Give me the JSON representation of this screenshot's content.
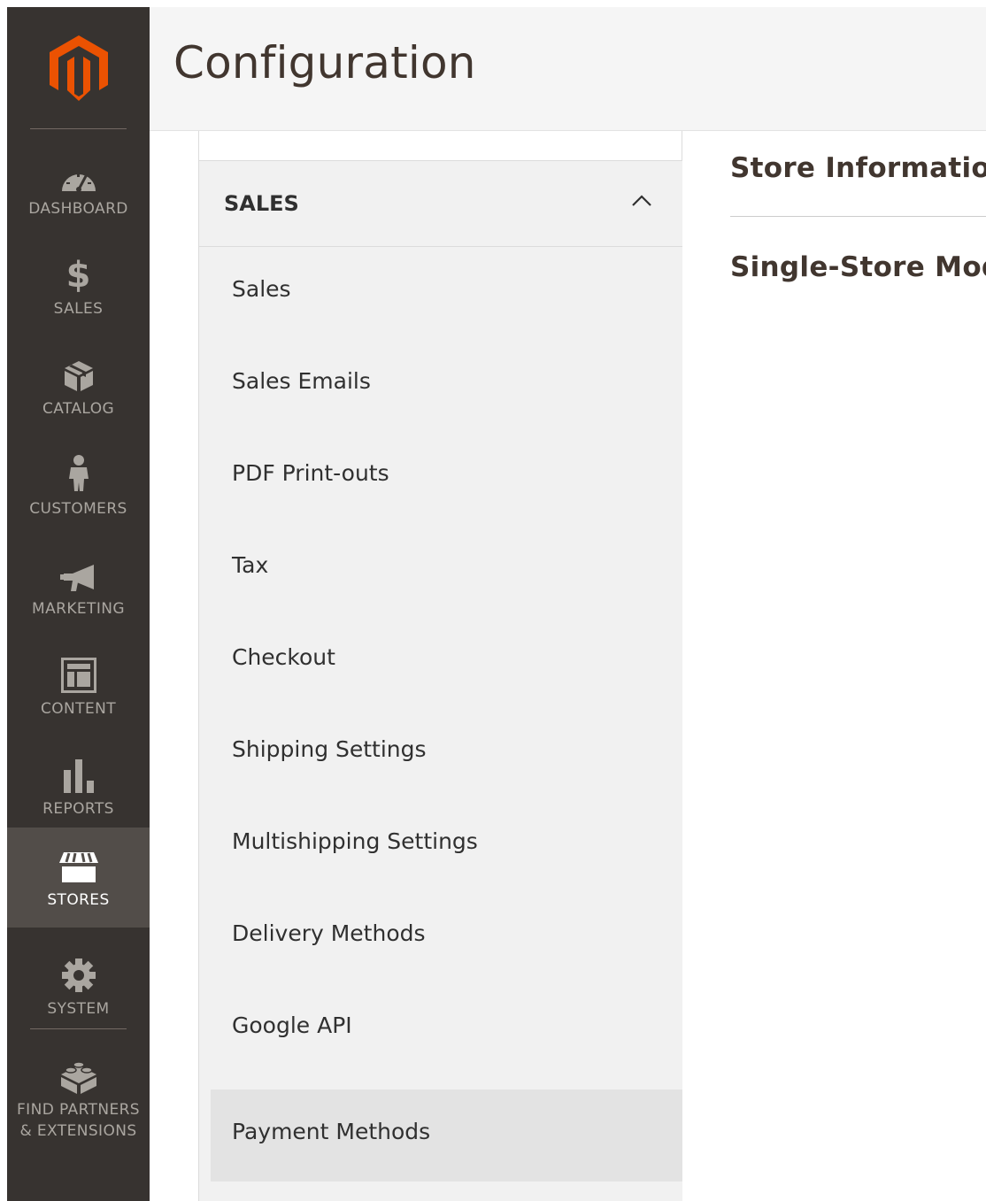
{
  "brand": {
    "logo": "magento-logo-icon",
    "accent_color": "#eb5202"
  },
  "admin_nav": {
    "items": [
      {
        "label": "DASHBOARD",
        "icon": "dashboard-gauge-icon"
      },
      {
        "label": "SALES",
        "icon": "dollar-icon"
      },
      {
        "label": "CATALOG",
        "icon": "box-icon"
      },
      {
        "label": "CUSTOMERS",
        "icon": "person-icon"
      },
      {
        "label": "MARKETING",
        "icon": "megaphone-icon"
      },
      {
        "label": "CONTENT",
        "icon": "layout-icon"
      },
      {
        "label": "REPORTS",
        "icon": "bar-chart-icon"
      },
      {
        "label": "STORES",
        "icon": "storefront-icon",
        "active": true
      },
      {
        "label": "SYSTEM",
        "icon": "gear-icon"
      },
      {
        "label": "FIND PARTNERS\n& EXTENSIONS",
        "icon": "blocks-icon"
      }
    ]
  },
  "header": {
    "title": "Configuration"
  },
  "config_tabs": {
    "section": {
      "title": "SALES",
      "expanded": true
    },
    "items": [
      "Sales",
      "Sales Emails",
      "PDF Print-outs",
      "Tax",
      "Checkout",
      "Shipping Settings",
      "Multishipping Settings",
      "Delivery Methods",
      "Google API",
      "Payment Methods"
    ],
    "selected": "Payment Methods"
  },
  "content": {
    "groups": [
      "Store Information",
      "Single-Store Mode"
    ]
  },
  "colors": {
    "nav_bg": "#373330",
    "nav_active_bg": "#524d49",
    "header_bg": "#f5f5f5",
    "tabs_bg": "#f1f1f1",
    "tab_selected_bg": "#e3e3e3",
    "title_text": "#41362f"
  }
}
